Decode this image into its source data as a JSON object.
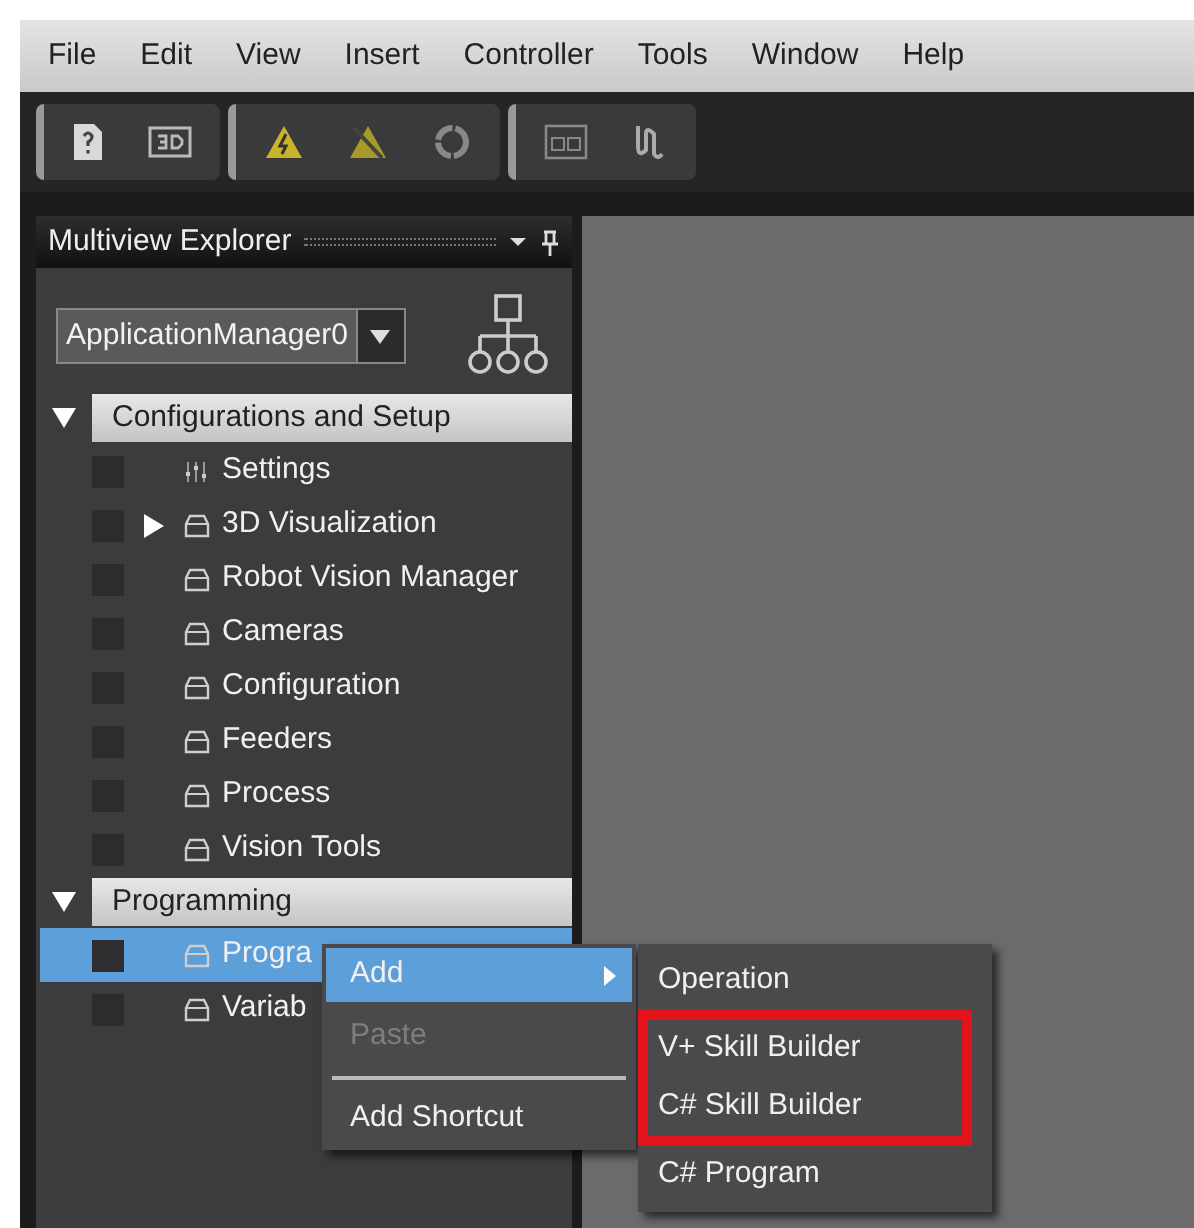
{
  "menu_bar": [
    "File",
    "Edit",
    "View",
    "Insert",
    "Controller",
    "Tools",
    "Window",
    "Help"
  ],
  "toolbar": [
    [
      {
        "kind": "help"
      },
      {
        "kind": "view"
      }
    ],
    [
      {
        "kind": "warning"
      },
      {
        "kind": "mute"
      },
      {
        "kind": "sync"
      }
    ],
    [
      {
        "kind": "display"
      },
      {
        "kind": "cable"
      }
    ]
  ],
  "panel": {
    "title": "Multiview Explorer",
    "dropdown": {
      "value": "ApplicationManager0"
    }
  },
  "tree": [
    {
      "label": "Configurations and Setup",
      "expanded": true,
      "children": [
        {
          "label": "Settings",
          "kind": "settings",
          "has_children": false,
          "selected": false
        },
        {
          "label": "3D Visualization",
          "kind": "folder",
          "has_children": true,
          "selected": false
        },
        {
          "label": "Robot Vision Manager",
          "kind": "folder",
          "has_children": false,
          "selected": false
        },
        {
          "label": "Cameras",
          "kind": "folder",
          "has_children": false,
          "selected": false
        },
        {
          "label": "Configuration",
          "kind": "folder",
          "has_children": false,
          "selected": false
        },
        {
          "label": "Feeders",
          "kind": "folder",
          "has_children": false,
          "selected": false
        },
        {
          "label": "Process",
          "kind": "folder",
          "has_children": false,
          "selected": false
        },
        {
          "label": "Vision Tools",
          "kind": "folder",
          "has_children": false,
          "selected": false
        }
      ]
    },
    {
      "label": "Programming",
      "expanded": true,
      "children": [
        {
          "label": "Progra",
          "kind": "folder",
          "has_children": false,
          "selected": true
        },
        {
          "label": "Variab",
          "kind": "folder",
          "has_children": false,
          "selected": false
        }
      ]
    }
  ],
  "context_menu": [
    {
      "label": "Add",
      "kind": "submenu",
      "selected": true,
      "disabled": false
    },
    {
      "label": "Paste",
      "kind": "item",
      "selected": false,
      "disabled": true
    },
    {
      "kind": "separator"
    },
    {
      "label": "Add Shortcut",
      "kind": "item",
      "selected": false,
      "disabled": false
    }
  ],
  "submenu": [
    {
      "label": "Operation",
      "highlighted": false
    },
    {
      "label": "V+ Skill Builder",
      "highlighted": true
    },
    {
      "label": "C# Skill Builder",
      "highlighted": true
    },
    {
      "label": "C# Program",
      "highlighted": false
    }
  ]
}
